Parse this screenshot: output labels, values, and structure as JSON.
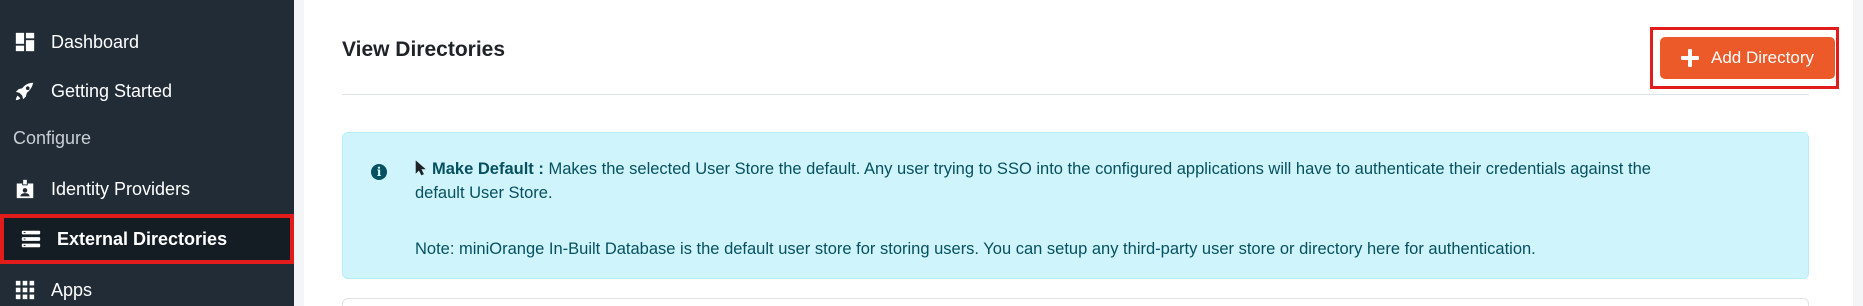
{
  "sidebar": {
    "items": [
      {
        "label": "Dashboard",
        "icon": "dashboard-icon"
      },
      {
        "label": "Getting Started",
        "icon": "rocket-icon"
      },
      {
        "label": "Identity Providers",
        "icon": "id-badge-icon"
      },
      {
        "label": "External Directories",
        "icon": "server-list-icon"
      },
      {
        "label": "Apps",
        "icon": "grid-icon"
      }
    ],
    "section_label": "Configure",
    "active_item": "External Directories"
  },
  "main": {
    "title": "View Directories",
    "add_button_label": "Add Directory",
    "info": {
      "bold_label": "Make Default :",
      "description": "Makes the selected User Store the default. Any user trying to SSO into the configured applications will have to authenticate their credentials against the default User Store.",
      "note": "Note: miniOrange In-Built Database is the default user store for storing users. You can setup any third-party user store or directory here for authentication."
    }
  },
  "colors": {
    "sidebar_bg": "#212c36",
    "accent": "#ec5a29",
    "highlight": "#e21b1b",
    "info_bg": "#cff4fc",
    "info_text": "#055160"
  }
}
